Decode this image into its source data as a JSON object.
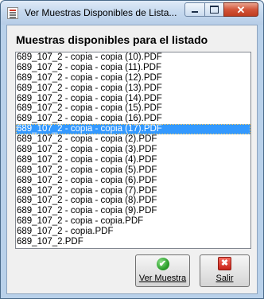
{
  "window": {
    "title": "Ver Muestras Disponibles de Lista...",
    "minimize_glyph": "–",
    "close_glyph": "✕"
  },
  "heading": "Muestras disponibles para el listado",
  "list": {
    "items": [
      "689_107_2 - copia - copia (10).PDF",
      "689_107_2 - copia - copia (11).PDF",
      "689_107_2 - copia - copia (12).PDF",
      "689_107_2 - copia - copia (13).PDF",
      "689_107_2 - copia - copia (14).PDF",
      "689_107_2 - copia - copia (15).PDF",
      "689_107_2 - copia - copia (16).PDF",
      "689_107_2 - copia - copia (17).PDF",
      "689_107_2 - copia - copia (2).PDF",
      "689_107_2 - copia - copia (3).PDF",
      "689_107_2 - copia - copia (4).PDF",
      "689_107_2 - copia - copia (5).PDF",
      "689_107_2 - copia - copia (6).PDF",
      "689_107_2 - copia - copia (7).PDF",
      "689_107_2 - copia - copia (8).PDF",
      "689_107_2 - copia - copia (9).PDF",
      "689_107_2 - copia - copia.PDF",
      "689_107_2 - copia.PDF",
      "689_107_2.PDF"
    ],
    "selected_index": 7
  },
  "buttons": {
    "view_label": "Ver Muestra",
    "exit_label": "Salir",
    "view_icon": "check-icon",
    "exit_icon": "x-icon",
    "check_glyph": "✔",
    "x_glyph": "✖"
  },
  "colors": {
    "selection": "#3399ff",
    "check_icon": "#2c9f2c",
    "exit_icon": "#c8231a"
  }
}
